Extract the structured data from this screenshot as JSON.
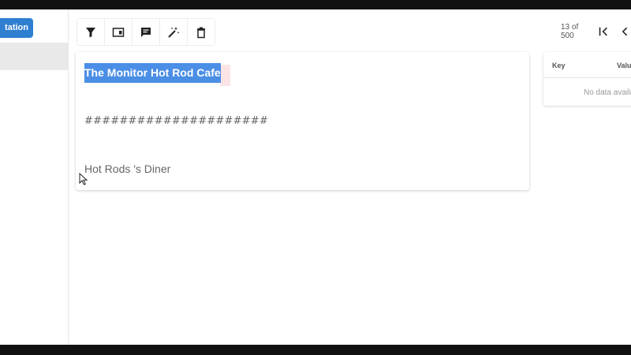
{
  "sidebar": {
    "annotation_button_label": "tation"
  },
  "toolbar": {
    "buttons": [
      {
        "icon": "filter-icon"
      },
      {
        "icon": "layout-icon"
      },
      {
        "icon": "comment-icon"
      },
      {
        "icon": "magic-wand-icon"
      },
      {
        "icon": "delete-icon"
      }
    ]
  },
  "pagination": {
    "text": "13 of 500"
  },
  "document": {
    "title": "The Monitor Hot Rod Cafe",
    "divider": "#####################",
    "body": "Hot Rods 's Diner"
  },
  "side_table": {
    "headers": [
      "Key",
      "Value"
    ],
    "empty_text": "No data available"
  },
  "colors": {
    "accent": "#2f7fd1",
    "selection": "#4a8ee6",
    "sidebar_selected": "#e9e9e9"
  }
}
